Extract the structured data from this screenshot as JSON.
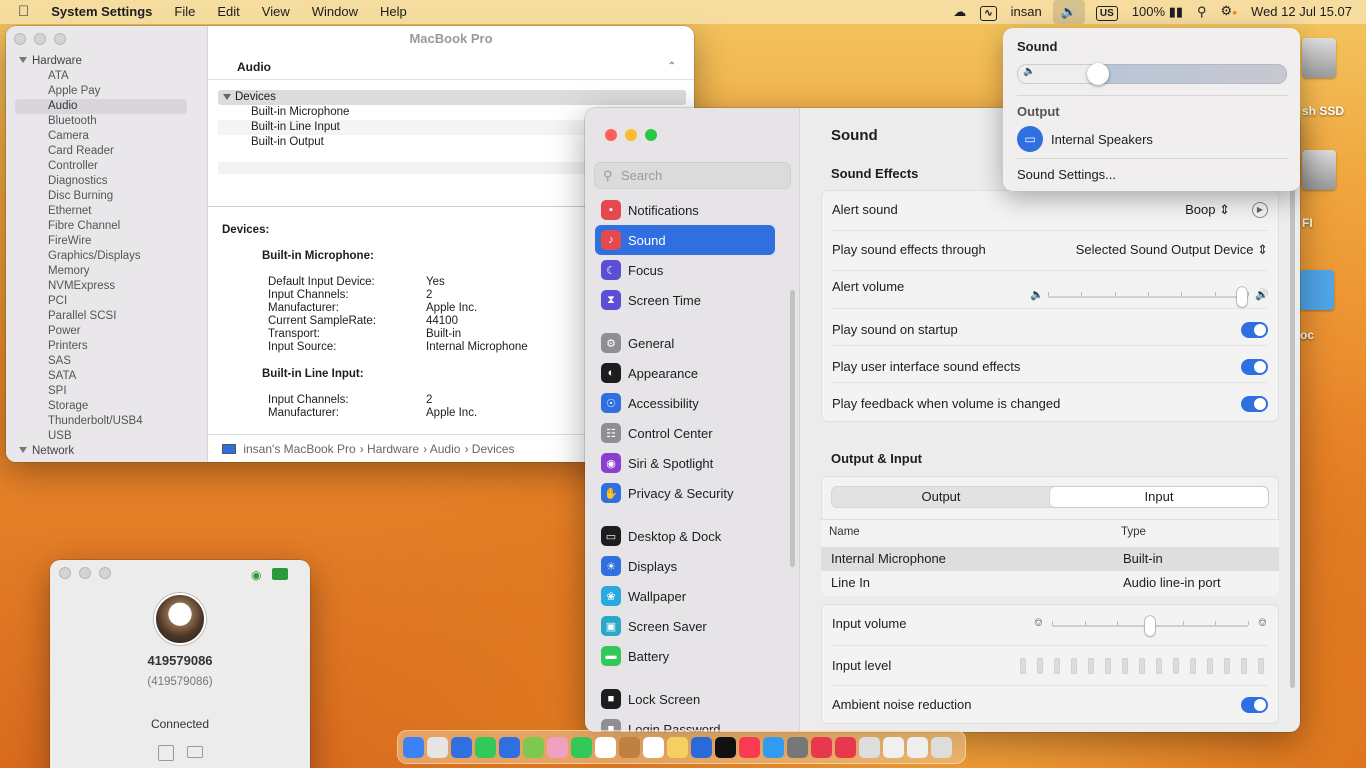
{
  "menubar": {
    "app": "System Settings",
    "items": [
      "File",
      "Edit",
      "View",
      "Window",
      "Help"
    ],
    "user": "insan",
    "input_source": "US",
    "battery": "100%",
    "datetime": "Wed 12 Jul  15.07"
  },
  "sysinfo": {
    "title": "MacBook Pro",
    "sidebar": [
      {
        "label": "Hardware",
        "head": true
      },
      {
        "label": "ATA"
      },
      {
        "label": "Apple Pay"
      },
      {
        "label": "Audio",
        "selected": true
      },
      {
        "label": "Bluetooth"
      },
      {
        "label": "Camera"
      },
      {
        "label": "Card Reader"
      },
      {
        "label": "Controller"
      },
      {
        "label": "Diagnostics"
      },
      {
        "label": "Disc Burning"
      },
      {
        "label": "Ethernet"
      },
      {
        "label": "Fibre Channel"
      },
      {
        "label": "FireWire"
      },
      {
        "label": "Graphics/Displays"
      },
      {
        "label": "Memory"
      },
      {
        "label": "NVMExpress"
      },
      {
        "label": "PCI"
      },
      {
        "label": "Parallel SCSI"
      },
      {
        "label": "Power"
      },
      {
        "label": "Printers"
      },
      {
        "label": "SAS"
      },
      {
        "label": "SATA"
      },
      {
        "label": "SPI"
      },
      {
        "label": "Storage"
      },
      {
        "label": "Thunderbolt/USB4"
      },
      {
        "label": "USB"
      },
      {
        "label": "Network",
        "head": true
      }
    ],
    "section": "Audio",
    "group": "Devices",
    "devices": [
      "Built-in Microphone",
      "Built-in Line Input",
      "Built-in Output"
    ],
    "detail_title": "Devices:",
    "mic_title": "Built-in Microphone:",
    "mic": [
      [
        "Default Input Device:",
        "Yes"
      ],
      [
        "Input Channels:",
        "2"
      ],
      [
        "Manufacturer:",
        "Apple Inc."
      ],
      [
        "Current SampleRate:",
        "44100"
      ],
      [
        "Transport:",
        "Built-in"
      ],
      [
        "Input Source:",
        "Internal Microphone"
      ]
    ],
    "line_title": "Built-in Line Input:",
    "line": [
      [
        "Input Channels:",
        "2"
      ],
      [
        "Manufacturer:",
        "Apple Inc."
      ]
    ],
    "path": [
      "insan's MacBook Pro",
      "Hardware",
      "Audio",
      "Devices"
    ]
  },
  "remote": {
    "id": "419579086",
    "id_sub": "(419579086)",
    "status": "Connected"
  },
  "settings": {
    "search_placeholder": "Search",
    "nav": [
      {
        "label": "Notifications",
        "color": "#e5484d",
        "glyph": "▪"
      },
      {
        "label": "Sound",
        "color": "#e5484d",
        "glyph": "♪",
        "active": true
      },
      {
        "label": "Focus",
        "color": "#5b4fd6",
        "glyph": "☾"
      },
      {
        "label": "Screen Time",
        "color": "#5b4fd6",
        "glyph": "⧗"
      },
      {
        "label": "General",
        "color": "#8e8e93",
        "glyph": "⚙"
      },
      {
        "label": "Appearance",
        "color": "#1d1d1f",
        "glyph": "◐"
      },
      {
        "label": "Accessibility",
        "color": "#2f6fe0",
        "glyph": "☉"
      },
      {
        "label": "Control Center",
        "color": "#8e8e93",
        "glyph": "☷"
      },
      {
        "label": "Siri & Spotlight",
        "color": "#8a3fd1",
        "glyph": "◉"
      },
      {
        "label": "Privacy & Security",
        "color": "#2f6fe0",
        "glyph": "✋"
      },
      {
        "label": "Desktop & Dock",
        "color": "#1d1d1f",
        "glyph": "▭"
      },
      {
        "label": "Displays",
        "color": "#2f6fe0",
        "glyph": "☀"
      },
      {
        "label": "Wallpaper",
        "color": "#2aa8e0",
        "glyph": "❀"
      },
      {
        "label": "Screen Saver",
        "color": "#2aa8c8",
        "glyph": "▣"
      },
      {
        "label": "Battery",
        "color": "#34c759",
        "glyph": "▬"
      },
      {
        "label": "Lock Screen",
        "color": "#1d1d1f",
        "glyph": "■"
      },
      {
        "label": "Login Password",
        "color": "#8e8e93",
        "glyph": "■"
      }
    ],
    "title": "Sound",
    "effects_header": "Sound Effects",
    "alert_sound_label": "Alert sound",
    "alert_sound_value": "Boop",
    "through_label": "Play sound effects through",
    "through_value": "Selected Sound Output Device",
    "alert_volume_label": "Alert volume",
    "alert_volume_level": 0.97,
    "toggles": [
      {
        "label": "Play sound on startup",
        "on": true
      },
      {
        "label": "Play user interface sound effects",
        "on": true
      },
      {
        "label": "Play feedback when volume is changed",
        "on": true
      }
    ],
    "io_header": "Output & Input",
    "tabs": [
      "Output",
      "Input"
    ],
    "selected_tab": "Input",
    "col_name": "Name",
    "col_type": "Type",
    "rows": [
      [
        "Internal Microphone",
        "Built-in"
      ],
      [
        "Line In",
        "Audio line-in port"
      ]
    ],
    "input_volume_label": "Input volume",
    "input_volume_level": 0.5,
    "input_level_label": "Input level",
    "noise_label": "Ambient noise reduction",
    "noise_on": true
  },
  "popover": {
    "title": "Sound",
    "volume_level": 0.3,
    "output_header": "Output",
    "output_device": "Internal Speakers",
    "settings_link": "Sound Settings..."
  },
  "desktop": {
    "labels": [
      "sh SSD",
      "FI",
      "oc"
    ]
  }
}
